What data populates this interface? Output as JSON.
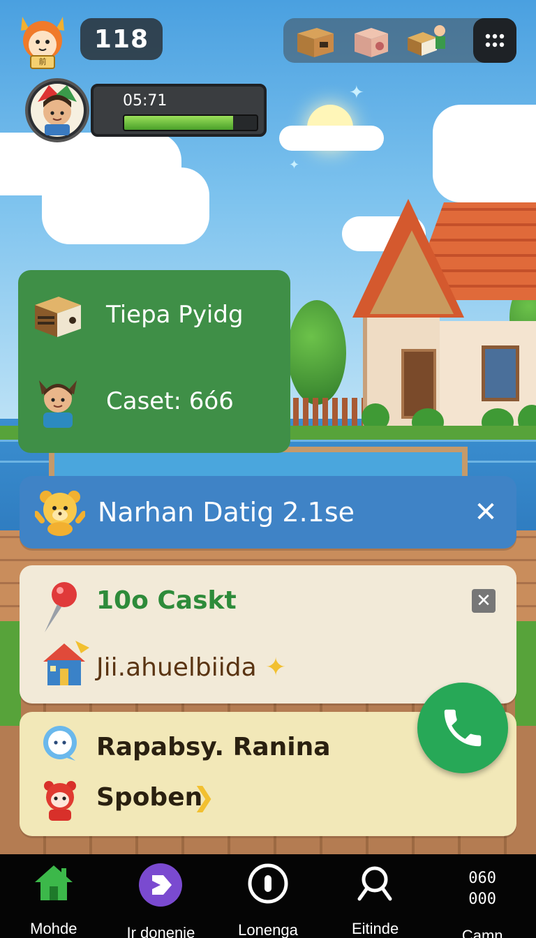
{
  "hud": {
    "coins": "118",
    "timer": "05:71",
    "timer_progress": 0.82,
    "mascot_badge": "前"
  },
  "inventory": {
    "items": [
      "crate-icon",
      "gift-box-icon",
      "book-stack-icon"
    ],
    "menu_icon": "grid-menu-icon"
  },
  "panels": {
    "green": {
      "row1_label": "Tiepa Pyidg",
      "row2_label": "Caset: 6ó6"
    },
    "blue_banner": {
      "label": "Narhan Datig 2.1se",
      "close_label": "✕"
    },
    "cream": {
      "title": "10o Caskt",
      "subtitle": "Jii.ahuelbiida",
      "close_label": "✕",
      "title_color": "#2e8b3a"
    },
    "yellow": {
      "row1_label": "Rapabsy. Ranina",
      "row2_label": "Spoben"
    }
  },
  "bottom_nav": {
    "items": [
      {
        "label": "Mohde",
        "icon": "home-icon"
      },
      {
        "label": "Ir donenje",
        "icon": "purple-arrow-icon"
      },
      {
        "label": "Lonenga",
        "icon": "circle-pause-icon"
      },
      {
        "label": "Eitinde",
        "icon": "search-icon"
      },
      {
        "label": "Camn",
        "code_line1": "060",
        "code_line2": "000"
      }
    ]
  },
  "colors": {
    "green_panel": "#3f8f47",
    "blue_banner": "#3f83c6",
    "call_button": "#27a857",
    "timer_fill": "#6cc23a"
  }
}
